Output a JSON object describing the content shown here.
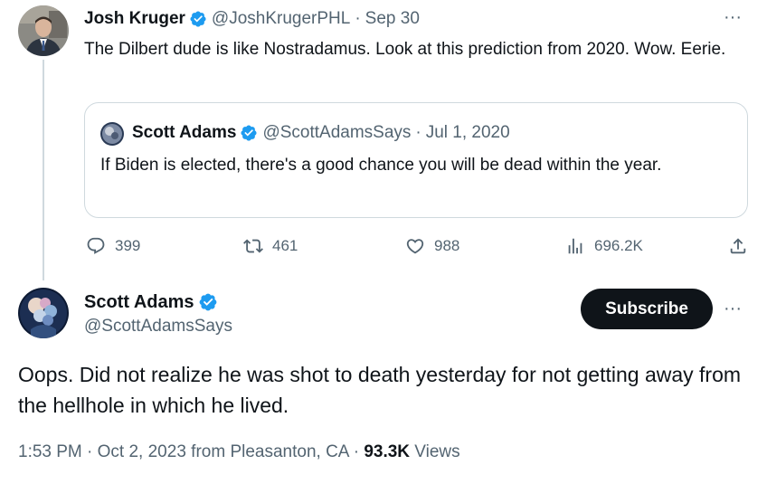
{
  "first_tweet": {
    "author_name": "Josh Kruger",
    "handle": "@JoshKrugerPHL",
    "separator": "·",
    "date": "Sep 30",
    "text": "The Dilbert dude is like Nostradamus. Look at this prediction from 2020. Wow. Eerie.",
    "more_label": "···",
    "quoted": {
      "author_name": "Scott Adams",
      "handle": "@ScottAdamsSays",
      "separator": "·",
      "date": "Jul 1, 2020",
      "text": "If Biden is elected, there's a good chance you will be dead within the year."
    },
    "actions": {
      "replies": "399",
      "reposts": "461",
      "likes": "988",
      "views": "696.2K"
    }
  },
  "main_tweet": {
    "author_name": "Scott Adams",
    "handle": "@ScottAdamsSays",
    "subscribe_label": "Subscribe",
    "more_label": "···",
    "text": "Oops. Did not realize he was shot to death yesterday for not getting away from the hellhole in which he lived.",
    "meta": {
      "time": "1:53 PM",
      "dot1": " · ",
      "date": "Oct 2, 2023",
      "location": " from Pleasanton, CA",
      "dot2": " · ",
      "views_count": "93.3K",
      "views_label": " Views"
    }
  },
  "colors": {
    "verified": "#1d9bf0",
    "secondary_text": "#536471",
    "border": "#cfd9de",
    "primary_text": "#0f1419"
  },
  "icons": [
    "verified-badge-icon",
    "reply-icon",
    "repost-icon",
    "like-icon",
    "views-icon",
    "share-icon",
    "more-icon"
  ]
}
